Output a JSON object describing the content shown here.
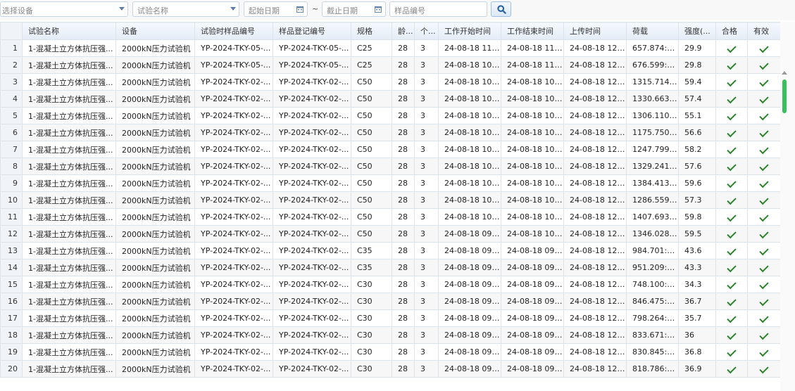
{
  "toolbar": {
    "device_placeholder": "选择设备",
    "test_name_placeholder": "试验名称",
    "start_date_placeholder": "起始日期",
    "separator": "~",
    "end_date_placeholder": "截止日期",
    "sample_no_placeholder": "样品编号"
  },
  "columns": [
    "试验名称",
    "设备",
    "试验时样品编号",
    "样品登记编号",
    "规格",
    "龄...",
    "个...",
    "工作开始时间",
    "工作结束时间",
    "上传时间",
    "荷载",
    "强度(...",
    "合格",
    "有效"
  ],
  "rows": [
    {
      "n": "1",
      "name": "1-混凝土立方体抗压强...",
      "device": "2000kN压力试验机",
      "sample": "YP-2024-TKY-05-...",
      "reg": "YP-2024-TKY-05-...",
      "spec": "C25",
      "age": "28",
      "count": "3",
      "start": "24-08-18 11:...",
      "end": "24-08-18 11:...",
      "upload": "24-08-18 12:...",
      "load": "657.874:6...",
      "strength": "29.9"
    },
    {
      "n": "2",
      "name": "1-混凝土立方体抗压强...",
      "device": "2000kN压力试验机",
      "sample": "YP-2024-TKY-05-...",
      "reg": "YP-2024-TKY-05-...",
      "spec": "C25",
      "age": "28",
      "count": "3",
      "start": "24-08-18 10:...",
      "end": "24-08-18 11:...",
      "upload": "24-08-18 12:...",
      "load": "676.599:6...",
      "strength": "29.8"
    },
    {
      "n": "3",
      "name": "1-混凝土立方体抗压强...",
      "device": "2000kN压力试验机",
      "sample": "YP-2024-TKY-02-...",
      "reg": "YP-2024-TKY-02-...",
      "spec": "C50",
      "age": "28",
      "count": "3",
      "start": "24-08-18 10:...",
      "end": "24-08-18 10:...",
      "upload": "24-08-18 12:...",
      "load": "1315.714:...",
      "strength": "59.4"
    },
    {
      "n": "4",
      "name": "1-混凝土立方体抗压强...",
      "device": "2000kN压力试验机",
      "sample": "YP-2024-TKY-02-...",
      "reg": "YP-2024-TKY-02-...",
      "spec": "C50",
      "age": "28",
      "count": "3",
      "start": "24-08-18 10:...",
      "end": "24-08-18 10:...",
      "upload": "24-08-18 12:...",
      "load": "1330.663:...",
      "strength": "57.4"
    },
    {
      "n": "5",
      "name": "1-混凝土立方体抗压强...",
      "device": "2000kN压力试验机",
      "sample": "YP-2024-TKY-02-...",
      "reg": "YP-2024-TKY-02-...",
      "spec": "C50",
      "age": "28",
      "count": "3",
      "start": "24-08-18 10:...",
      "end": "24-08-18 10:...",
      "upload": "24-08-18 12:...",
      "load": "1306.110:...",
      "strength": "55.1"
    },
    {
      "n": "6",
      "name": "1-混凝土立方体抗压强...",
      "device": "2000kN压力试验机",
      "sample": "YP-2024-TKY-02-...",
      "reg": "YP-2024-TKY-02-...",
      "spec": "C50",
      "age": "28",
      "count": "3",
      "start": "24-08-18 10:...",
      "end": "24-08-18 10:...",
      "upload": "24-08-18 12:...",
      "load": "1175.750:...",
      "strength": "56.6"
    },
    {
      "n": "7",
      "name": "1-混凝土立方体抗压强...",
      "device": "2000kN压力试验机",
      "sample": "YP-2024-TKY-02-...",
      "reg": "YP-2024-TKY-02-...",
      "spec": "C50",
      "age": "28",
      "count": "3",
      "start": "24-08-18 10:...",
      "end": "24-08-18 10:...",
      "upload": "24-08-18 12:...",
      "load": "1247.799:...",
      "strength": "58.2"
    },
    {
      "n": "8",
      "name": "1-混凝土立方体抗压强...",
      "device": "2000kN压力试验机",
      "sample": "YP-2024-TKY-02-...",
      "reg": "YP-2024-TKY-02-...",
      "spec": "C50",
      "age": "28",
      "count": "3",
      "start": "24-08-18 10:...",
      "end": "24-08-18 10:...",
      "upload": "24-08-18 12:...",
      "load": "1329.241:...",
      "strength": "57.6"
    },
    {
      "n": "9",
      "name": "1-混凝土立方体抗压强...",
      "device": "2000kN压力试验机",
      "sample": "YP-2024-TKY-02-...",
      "reg": "YP-2024-TKY-02-...",
      "spec": "C50",
      "age": "28",
      "count": "3",
      "start": "24-08-18 10:...",
      "end": "24-08-18 10:...",
      "upload": "24-08-18 12:...",
      "load": "1384.413:...",
      "strength": "59.6"
    },
    {
      "n": "10",
      "name": "1-混凝土立方体抗压强...",
      "device": "2000kN压力试验机",
      "sample": "YP-2024-TKY-02-...",
      "reg": "YP-2024-TKY-02-...",
      "spec": "C50",
      "age": "28",
      "count": "3",
      "start": "24-08-18 10:...",
      "end": "24-08-18 10:...",
      "upload": "24-08-18 12:...",
      "load": "1286.559:...",
      "strength": "57.3"
    },
    {
      "n": "11",
      "name": "1-混凝土立方体抗压强...",
      "device": "2000kN压力试验机",
      "sample": "YP-2024-TKY-02-...",
      "reg": "YP-2024-TKY-02-...",
      "spec": "C50",
      "age": "28",
      "count": "3",
      "start": "24-08-18 10:...",
      "end": "24-08-18 10:...",
      "upload": "24-08-18 12:...",
      "load": "1407.693:...",
      "strength": "59.8"
    },
    {
      "n": "12",
      "name": "1-混凝土立方体抗压强...",
      "device": "2000kN压力试验机",
      "sample": "YP-2024-TKY-02-...",
      "reg": "YP-2024-TKY-02-...",
      "spec": "C50",
      "age": "28",
      "count": "3",
      "start": "24-08-18 09:...",
      "end": "24-08-18 10:...",
      "upload": "24-08-18 12:...",
      "load": "1346.028:...",
      "strength": "59.5"
    },
    {
      "n": "13",
      "name": "1-混凝土立方体抗压强...",
      "device": "2000kN压力试验机",
      "sample": "YP-2024-TKY-02-...",
      "reg": "YP-2024-TKY-02-...",
      "spec": "C35",
      "age": "28",
      "count": "3",
      "start": "24-08-18 09:...",
      "end": "24-08-18 09:...",
      "upload": "24-08-18 12:...",
      "load": "984.701:9...",
      "strength": "43.6"
    },
    {
      "n": "14",
      "name": "1-混凝土立方体抗压强...",
      "device": "2000kN压力试验机",
      "sample": "YP-2024-TKY-02-...",
      "reg": "YP-2024-TKY-02-...",
      "spec": "C35",
      "age": "28",
      "count": "3",
      "start": "24-08-18 09:...",
      "end": "24-08-18 09:...",
      "upload": "24-08-18 12:...",
      "load": "951.209:9...",
      "strength": "43.3"
    },
    {
      "n": "15",
      "name": "1-混凝土立方体抗压强...",
      "device": "2000kN压力试验机",
      "sample": "YP-2024-TKY-02-...",
      "reg": "YP-2024-TKY-02-...",
      "spec": "C30",
      "age": "28",
      "count": "3",
      "start": "24-08-18 09:...",
      "end": "24-08-18 09:...",
      "upload": "24-08-18 12:...",
      "load": "748.100:7...",
      "strength": "34.3"
    },
    {
      "n": "16",
      "name": "1-混凝土立方体抗压强...",
      "device": "2000kN压力试验机",
      "sample": "YP-2024-TKY-02-...",
      "reg": "YP-2024-TKY-02-...",
      "spec": "C30",
      "age": "28",
      "count": "3",
      "start": "24-08-18 09:...",
      "end": "24-08-18 09:...",
      "upload": "24-08-18 12:...",
      "load": "846.475:8...",
      "strength": "36.7"
    },
    {
      "n": "17",
      "name": "1-混凝土立方体抗压强...",
      "device": "2000kN压力试验机",
      "sample": "YP-2024-TKY-02-...",
      "reg": "YP-2024-TKY-02-...",
      "spec": "C30",
      "age": "28",
      "count": "3",
      "start": "24-08-18 09:...",
      "end": "24-08-18 09:...",
      "upload": "24-08-18 12:...",
      "load": "798.264:7...",
      "strength": "35.7"
    },
    {
      "n": "18",
      "name": "1-混凝土立方体抗压强...",
      "device": "2000kN压力试验机",
      "sample": "YP-2024-TKY-02-...",
      "reg": "YP-2024-TKY-02-...",
      "spec": "C30",
      "age": "28",
      "count": "3",
      "start": "24-08-18 09:...",
      "end": "24-08-18 09:...",
      "upload": "24-08-18 12:...",
      "load": "833.671:8...",
      "strength": "36"
    },
    {
      "n": "19",
      "name": "1-混凝土立方体抗压强...",
      "device": "2000kN压力试验机",
      "sample": "YP-2024-TKY-02-...",
      "reg": "YP-2024-TKY-02-...",
      "spec": "C30",
      "age": "28",
      "count": "3",
      "start": "24-08-18 09:...",
      "end": "24-08-18 09:...",
      "upload": "24-08-18 12:...",
      "load": "830.845:8...",
      "strength": "36.8"
    },
    {
      "n": "20",
      "name": "1-混凝土立方体抗压强...",
      "device": "2000kN压力试验机",
      "sample": "YP-2024-TKY-02-...",
      "reg": "YP-2024-TKY-02-...",
      "spec": "C30",
      "age": "28",
      "count": "3",
      "start": "24-08-18 09:...",
      "end": "24-08-18 09:...",
      "upload": "24-08-18 12:...",
      "load": "818.786:8...",
      "strength": "36.9"
    }
  ],
  "icons": {
    "pass": "check-icon",
    "valid": "check-icon",
    "search": "search-icon",
    "calendar": "calendar-icon"
  },
  "colors": {
    "check": "#28882b",
    "scroll_thumb": "#35c25a",
    "accent": "#3a78c3"
  }
}
